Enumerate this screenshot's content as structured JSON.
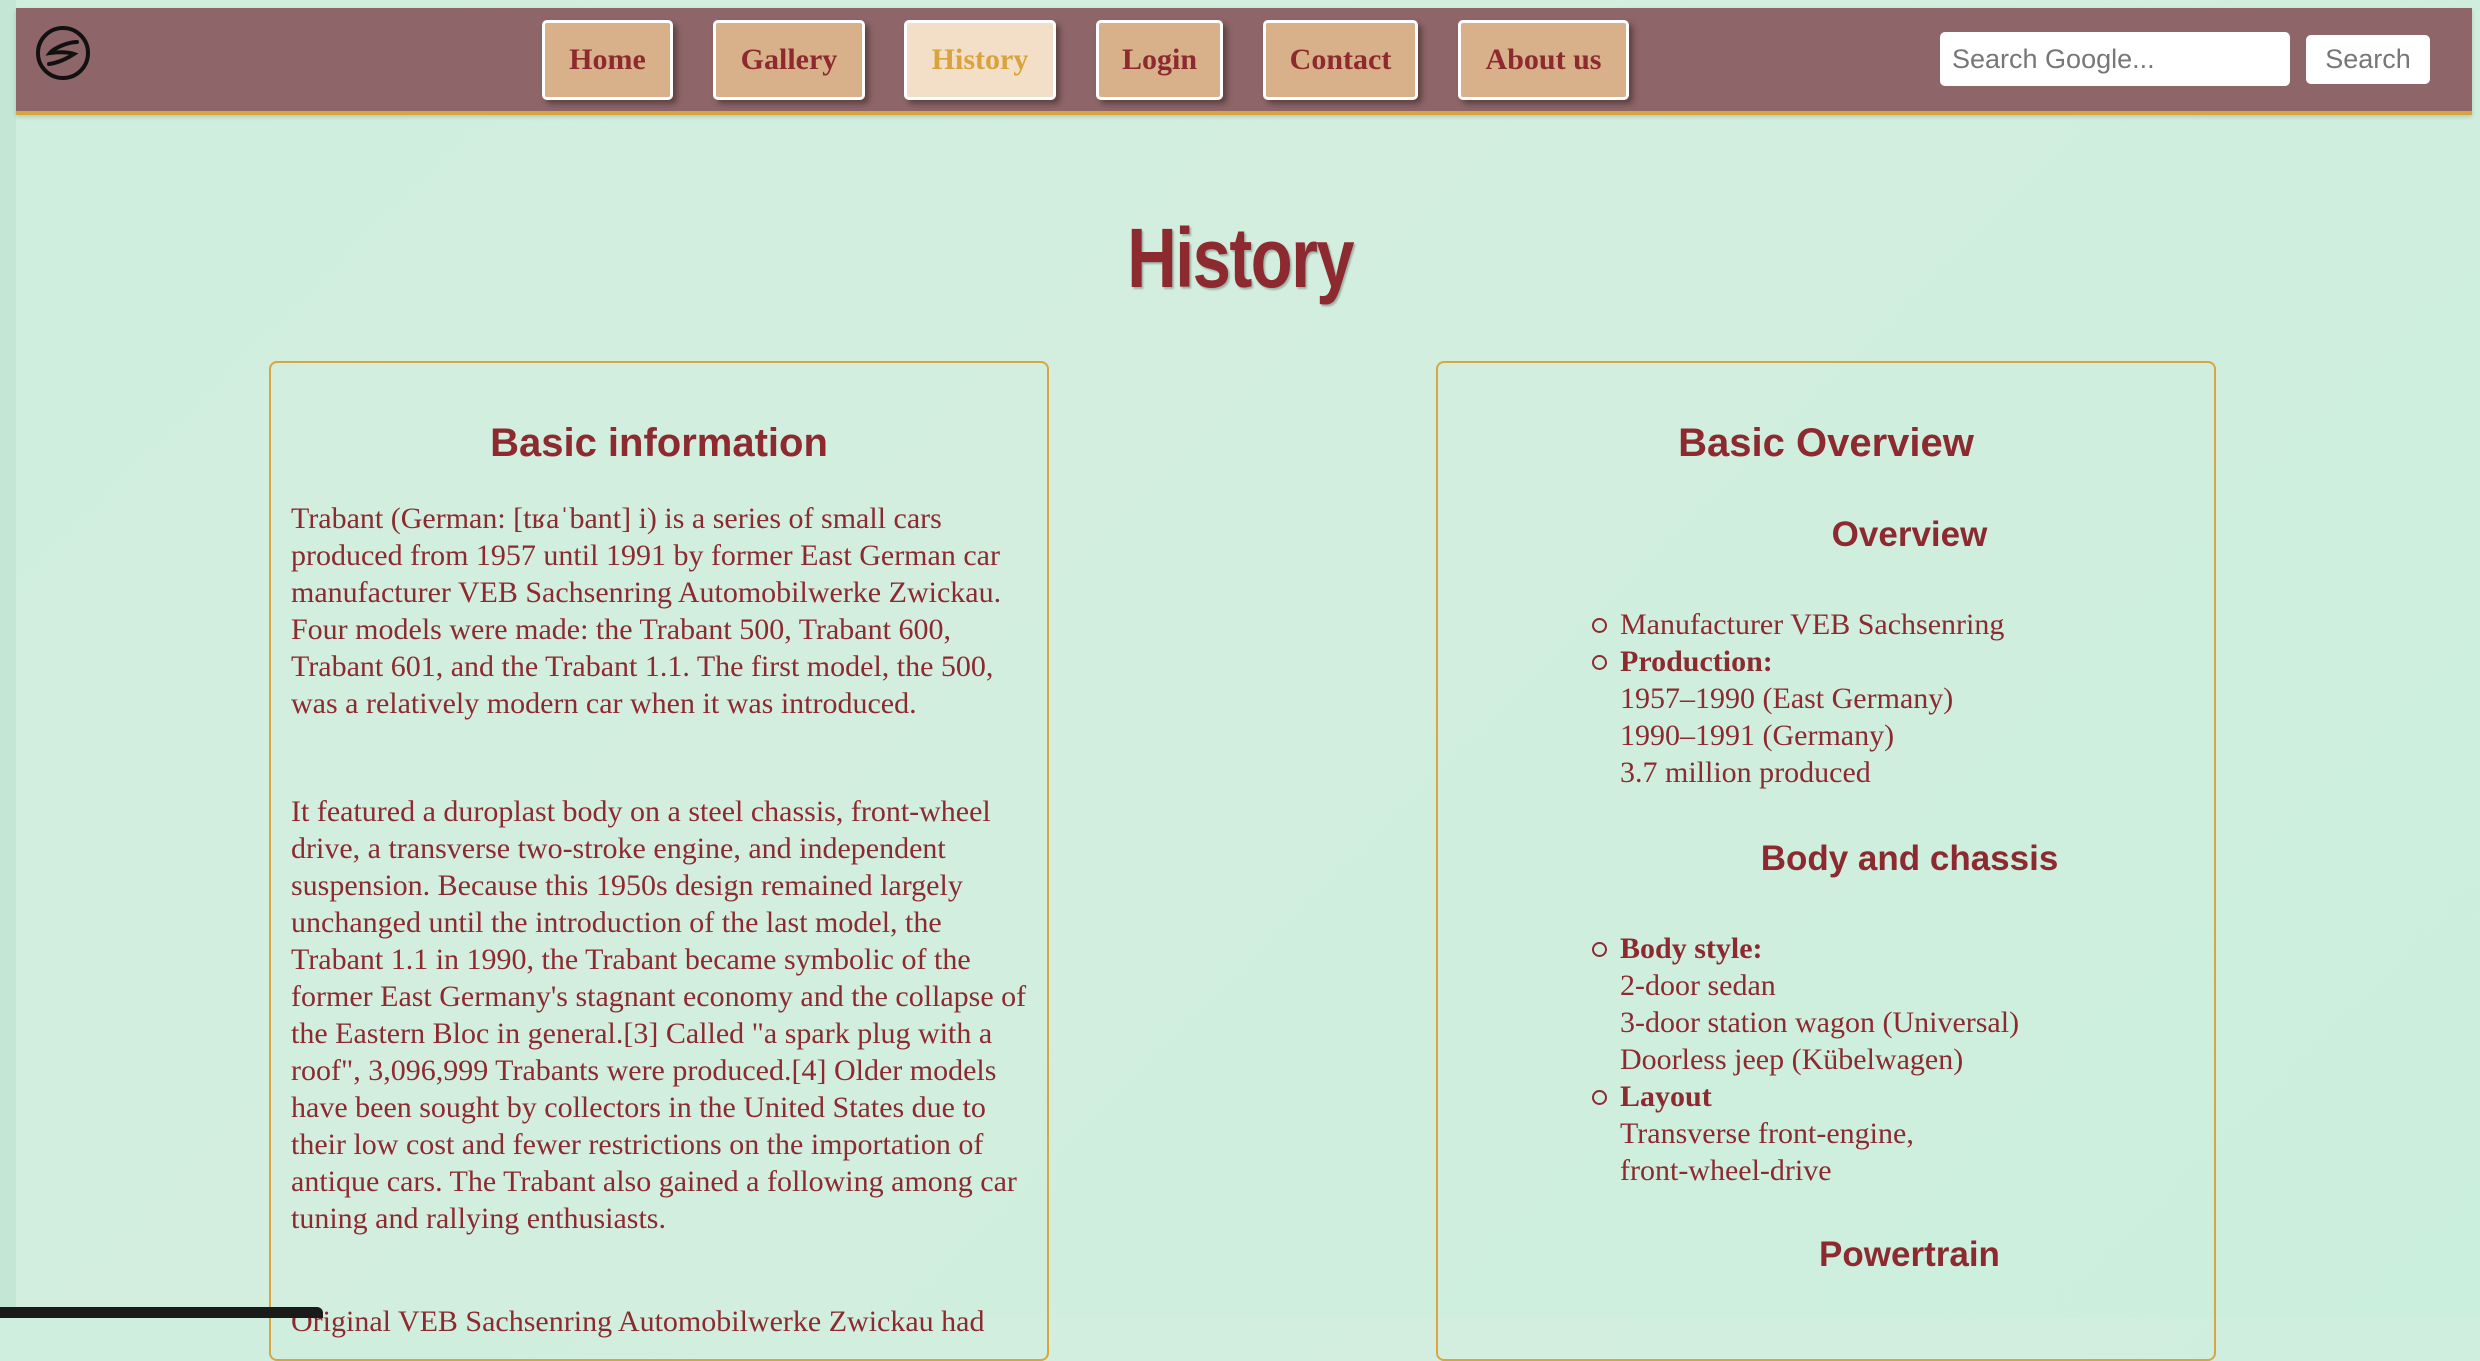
{
  "nav": {
    "items": [
      {
        "label": "Home",
        "active": false
      },
      {
        "label": "Gallery",
        "active": false
      },
      {
        "label": "History",
        "active": true
      },
      {
        "label": "Login",
        "active": false
      },
      {
        "label": "Contact",
        "active": false
      },
      {
        "label": "About us",
        "active": false
      }
    ],
    "search_placeholder": "Search Google...",
    "search_button": "Search"
  },
  "page": {
    "title": "History"
  },
  "basic_info": {
    "heading": "Basic information",
    "p1": "Trabant (German: [tʁaˈbant] i) is a series of small cars produced from 1957 until 1991 by former East German car manufacturer VEB Sachsenring Automobilwerke Zwickau. Four models were made: the Trabant 500, Trabant 600, Trabant 601, and the Trabant 1.1. The first model, the 500, was a relatively modern car when it was introduced.",
    "p2": "It featured a duroplast body on a steel chassis, front-wheel drive, a transverse two-stroke engine, and independent suspension. Because this 1950s design remained largely unchanged until the introduction of the last model, the Trabant 1.1 in 1990, the Trabant became symbolic of the former East Germany's stagnant economy and the collapse of the Eastern Bloc in general.[3] Called \"a spark plug with a roof\", 3,096,999 Trabants were produced.[4] Older models have been sought by collectors in the United States due to their low cost and fewer restrictions on the importation of antique cars. The Trabant also gained a following among car tuning and rallying enthusiasts.",
    "p3": "Original VEB Sachsenring Automobilwerke Zwickau had"
  },
  "overview": {
    "heading": "Basic Overview",
    "sections": [
      {
        "title": "Overview",
        "items": [
          {
            "label": "",
            "lines": [
              "Manufacturer VEB Sachsenring"
            ]
          },
          {
            "label": "Production:",
            "lines": [
              "1957–1990 (East Germany)",
              "1990–1991 (Germany)",
              "3.7 million produced"
            ]
          }
        ]
      },
      {
        "title": "Body and chassis",
        "items": [
          {
            "label": "Body style:",
            "lines": [
              "2-door sedan",
              "3-door station wagon (Universal)",
              "Doorless jeep (Kübelwagen)"
            ]
          },
          {
            "label": "Layout",
            "lines": [
              "Transverse front-engine,",
              "front-wheel-drive"
            ]
          }
        ]
      },
      {
        "title": "Powertrain",
        "items": []
      }
    ]
  },
  "colors": {
    "navbar": "#8e6568",
    "nav_button": "#d8b08a",
    "nav_button_active": "#f3dfc7",
    "accent_text": "#8c2a30",
    "active_text": "#d9a23c",
    "border_gold": "#d8a640",
    "page_background": "#cfeedd"
  }
}
